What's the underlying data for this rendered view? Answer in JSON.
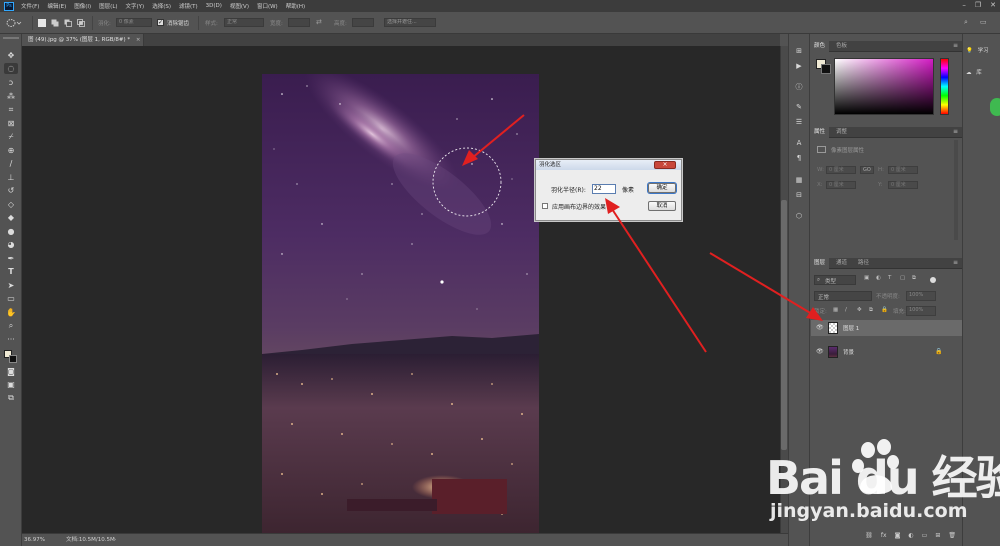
{
  "app": {
    "logo_text": "Ps"
  },
  "menu": {
    "items": [
      "文件(F)",
      "编辑(E)",
      "图像(I)",
      "图层(L)",
      "文字(Y)",
      "选择(S)",
      "滤镜(T)",
      "3D(D)",
      "视图(V)",
      "窗口(W)",
      "帮助(H)"
    ]
  },
  "options": {
    "feather_label": "羽化:",
    "feather_value": "0 像素",
    "antialias_label": "消除锯齿",
    "style_label": "样式:",
    "style_value": "正常",
    "width_label": "宽度:",
    "height_label": "高度:",
    "select_mask_button": "选择并遮住..."
  },
  "document": {
    "tab_title": "图 (49).jpg @ 37% (图层 1, RGB/8#) *",
    "tab_close": "×"
  },
  "status": {
    "zoom": "36.97%",
    "doc_size": "文档:10.5M/10.5M"
  },
  "dialog": {
    "title": "羽化选区",
    "close_label": "×",
    "radius_label": "羽化半径(R):",
    "radius_value": "22",
    "unit": "像素",
    "ok_label": "确定",
    "cancel_label": "取消",
    "apply_edge_label": "应用画布边界的效果"
  },
  "color_panel": {
    "tabs": [
      "颜色",
      "色板"
    ]
  },
  "properties_panel": {
    "tabs": [
      "属性",
      "调整"
    ],
    "subtitle": "像素图层属性",
    "w_label": "W:",
    "w_value": "0 厘米",
    "h_label": "H:",
    "h_value": "0 厘米",
    "x_label": "X:",
    "x_value": "0 厘米",
    "y_label": "Y:",
    "y_value": "0 厘米",
    "link_label": "GO"
  },
  "layers_panel": {
    "tabs": [
      "图层",
      "通道",
      "路径"
    ],
    "filter_label": "类型",
    "blend_mode": "正常",
    "opacity_label": "不透明度:",
    "opacity_value": "100%",
    "lock_label": "锁定:",
    "fill_label": "填充:",
    "fill_value": "100%",
    "layers": [
      {
        "name": "图层 1",
        "selected": true
      },
      {
        "name": "背景",
        "selected": false
      }
    ]
  },
  "far_right": {
    "learn_label": "学习",
    "libraries_label": "库"
  },
  "watermark": {
    "brand": "Bai du 经验",
    "site": "jingyan.baidu.com"
  }
}
